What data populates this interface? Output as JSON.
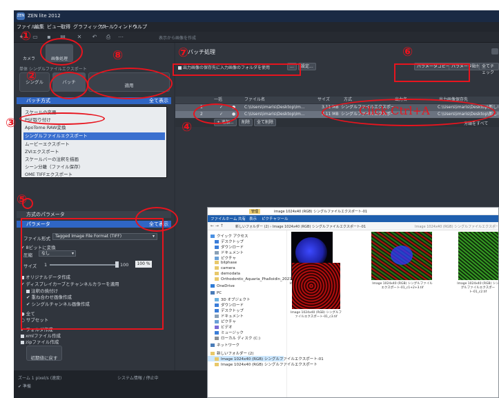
{
  "window": {
    "title": "ZEN lite 2012",
    "logo": "ZEN"
  },
  "menu": [
    "ファイル",
    "編集",
    "ビュー",
    "取得",
    "グラフィックス",
    "ツール",
    "ウィンドウ",
    "ヘルプ"
  ],
  "toolbar": {
    "hint": "表示から画像を作成"
  },
  "left": {
    "tab_camera": "カメラ",
    "tab_process": "画像処理",
    "mode_label": "単体 シングルファイルエクスポート",
    "btn_single": "シングル",
    "btn_batch": "バッチ",
    "btn_apply": "適用",
    "batch_header": "バッチ方式",
    "show_all": "全て表示",
    "methods": [
      "スケールの変更",
      "PSF取り付け",
      "ApoTome RAW変換",
      "シングルファイルエクスポート",
      "ムービーエクスポート",
      "ZVIエクスポート",
      "スケールバーの注釈を描画",
      "シーン分離（ファイル保存）",
      "OME TIFFエクスポート"
    ],
    "params_header": "方式のパラメータ",
    "params_sub": "パラメータ",
    "params_show_all": "全て表示",
    "file_format_label": "ファイル形式",
    "file_format_value": "Tagged Image File Format (TIFF)",
    "opt_8bit": "8ビットに変換",
    "compression_label": "圧縮",
    "compression_value": "なし",
    "size_label": "サイズ",
    "size_min": "1",
    "size_max": "100",
    "size_value": "100 %",
    "options": [
      "オリジナルデータ作成",
      "ディスプレイカーブとチャンネルカラーを適用",
      "注釈の焼付け",
      "重ね合わせ画像作成",
      "シングルチャンネル画像作成",
      "全て",
      "サブセット",
      "フォルダ作成",
      "xmlファイル作成",
      "zipファイル作成"
    ],
    "reset_button": "初期値に戻す"
  },
  "right": {
    "title": "バッチ処理",
    "use_input_folder": "出力画像の保存先に入力画像のフォルダを使用",
    "browse": "...",
    "settings_btn": "設定...",
    "copy_params": "パラメータコピー",
    "paste_params": "パラメータ貼付",
    "check_all": "全てチェック",
    "columns": [
      "",
      "一括",
      "ファイル名",
      "サイズ",
      "方式",
      "出力名",
      "出力画像保存先"
    ],
    "rows": [
      {
        "idx": "1",
        "file": "C:\\Users\\imaris\\Desktop\\Im...",
        "size": "3.11 MB",
        "method": "シングルファイルエクスポート",
        "out": "",
        "dest": "C:\\Users\\imaris\\Desktop\\新しい"
      },
      {
        "idx": "2",
        "file": "C:\\Users\\imaris\\Desktop\\Im...",
        "size": "3.11 MB",
        "method": "シングルファイルエクスポート",
        "out": "",
        "dest": "C:\\Users\\imaris\\Desktop\\新しい"
      }
    ],
    "add_btn": "追加...",
    "remove_btn": "削除",
    "remove_all_btn": "全て削除",
    "status_right": "分類をすべて",
    "annotation_click": "Click Ctrl+A"
  },
  "markers": [
    "①",
    "②",
    "③",
    "④",
    "⑤",
    "⑥",
    "⑦",
    "⑧"
  ],
  "statusbar": {
    "left1": "ズーム 1 pixel/s (速度)",
    "left2": "✔ 準備",
    "mid": "システム情報 / 停止中"
  },
  "explorer": {
    "title": "image 1024x40 (RGB) シングルファイルエクスポート-01",
    "tab_tool": "管理",
    "ribbon": [
      "ファイル",
      "ホーム",
      "共有",
      "表示",
      "ピクチャツール"
    ],
    "address": "新しいフォルダー (2) › Image 1024x40 (RGB) シングルファイルエクスポート-01",
    "search": "Image 1024x40 (RGB) シングルファイルエクスポート-01の検索",
    "nav": [
      "クイック アクセス",
      "デスクトップ",
      "ダウンロード",
      "ドキュメント",
      "ピクチャ",
      "bilphase",
      "camera",
      "demodata",
      "Orthodontic_Aquaria_Phalloidin_2021",
      "OneDrive",
      "PC",
      "3D オブジェクト",
      "ダウンロード",
      "デスクトップ",
      "ドキュメント",
      "ピクチャ",
      "ビデオ",
      "ミュージック",
      "ローカル ディスク (C:)",
      "ネットワーク",
      "新しいフォルダー (2)",
      "Image 1024x40 (RGB) シングルファイルエクスポート-01",
      "Image 1024x40 (RGB) シングルファイルエクスポート"
    ],
    "captions": [
      "Image 1024x40 (RGB) シングルファイルエクスポート-01_c1.tif",
      "Image 1024x40 (RGB) シングルファイルエクスポート-01_c1+2+3.tif",
      "Image 1024x40 (RGB) シングルファイルエクスポート-01_c2.tif",
      "Image 1024x40 (RGB) シングルファイルエクスポート-01_c3.tif"
    ]
  },
  "colors": {
    "accent": "#2f66c4",
    "annotation": "#e8141e",
    "panel": "#30353d"
  }
}
